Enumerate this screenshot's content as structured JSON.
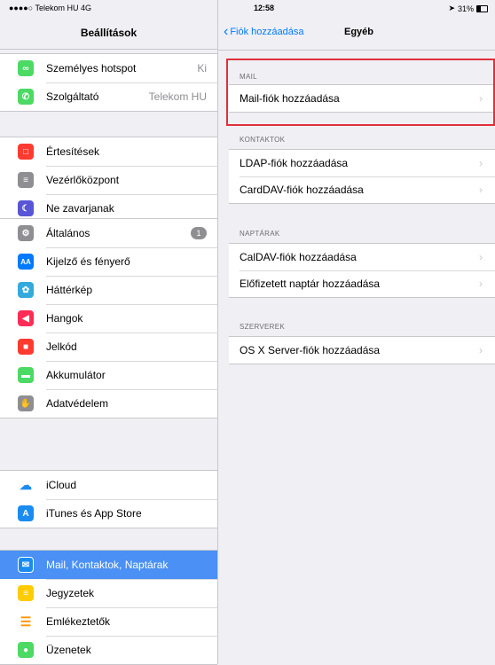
{
  "status_bar": {
    "carrier": "●●●●○ Telekom HU  4G",
    "time": "12:58",
    "battery": "31%"
  },
  "sidebar": {
    "title": "Beállítások",
    "groups": [
      [
        {
          "label": "Személyes hotspot",
          "value": "Ki",
          "icon": "hotspot-icon",
          "color": "#4cd964"
        },
        {
          "label": "Szolgáltató",
          "value": "Telekom HU",
          "icon": "phone-icon",
          "color": "#4cd964"
        }
      ],
      [
        {
          "label": "Értesítések",
          "icon": "notifications-icon",
          "color": "#ff3b30"
        },
        {
          "label": "Vezérlőközpont",
          "icon": "control-center-icon",
          "color": "#8e8e93"
        },
        {
          "label": "Ne zavarjanak",
          "icon": "moon-icon",
          "color": "#5856d6"
        }
      ],
      [
        {
          "label": "Általános",
          "badge": "1",
          "icon": "gear-icon",
          "color": "#8e8e93"
        },
        {
          "label": "Kijelző és fényerő",
          "icon": "display-icon",
          "color": "#007aff"
        },
        {
          "label": "Háttérkép",
          "icon": "wallpaper-icon",
          "color": "#34aadc"
        },
        {
          "label": "Hangok",
          "icon": "sound-icon",
          "color": "#ff2d55"
        },
        {
          "label": "Jelkód",
          "icon": "lock-icon",
          "color": "#ff3b30"
        },
        {
          "label": "Akkumulátor",
          "icon": "battery-icon",
          "color": "#4cd964"
        },
        {
          "label": "Adatvédelem",
          "icon": "hand-icon",
          "color": "#8e8e93"
        }
      ],
      [
        {
          "label": "iCloud",
          "icon": "cloud-icon",
          "color": "#ffffff"
        },
        {
          "label": "iTunes és App Store",
          "icon": "app-store-icon",
          "color": "#1a8cf0"
        }
      ],
      [
        {
          "label": "Mail, Kontaktok, Naptárak",
          "icon": "mail-icon",
          "color": "#1a8cf0",
          "selected": true
        },
        {
          "label": "Jegyzetek",
          "icon": "notes-icon",
          "color": "#ffcc00"
        },
        {
          "label": "Emlékeztetők",
          "icon": "reminders-icon",
          "color": "#ffffff"
        },
        {
          "label": "Üzenetek",
          "icon": "messages-icon",
          "color": "#4cd964"
        }
      ]
    ]
  },
  "nav": {
    "back_label": "Fiók hozzáadása",
    "title": "Egyéb"
  },
  "sections": [
    {
      "header": "MAIL",
      "items": [
        "Mail-fiók hozzáadása"
      ]
    },
    {
      "header": "KONTAKTOK",
      "items": [
        "LDAP-fiók hozzáadása",
        "CardDAV-fiók hozzáadása"
      ]
    },
    {
      "header": "NAPTÁRAK",
      "items": [
        "CalDAV-fiók hozzáadása",
        "Előfizetett naptár hozzáadása"
      ]
    },
    {
      "header": "SZERVEREK",
      "items": [
        "OS X Server-fiók hozzáadása"
      ]
    }
  ],
  "colors": {
    "accent": "#007aff",
    "selected_bg": "#4a90f5",
    "highlight": "#e0303c"
  }
}
